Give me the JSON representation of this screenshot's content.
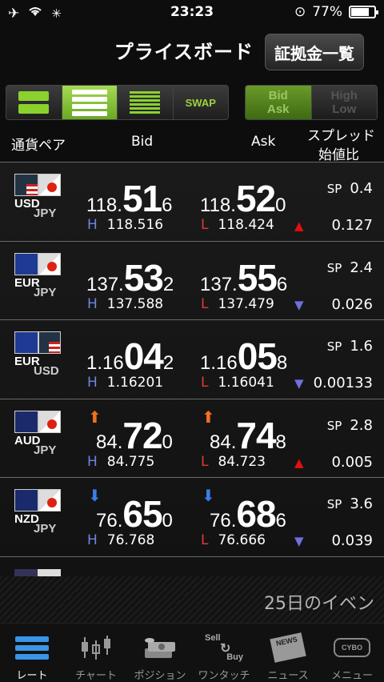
{
  "status": {
    "time": "23:23",
    "battery": "77%"
  },
  "header": {
    "title": "プライスボード",
    "button": "証拠金一覧"
  },
  "toggles": {
    "swap": "SWAP",
    "bidask_1": "Bid",
    "bidask_2": "Ask",
    "highlow_1": "High",
    "highlow_2": "Low"
  },
  "columns": {
    "pair": "通貨ペア",
    "bid": "Bid",
    "ask": "Ask",
    "spread": "スプレッド",
    "ratio": "始値比"
  },
  "rows": [
    {
      "base": "USD",
      "quote": "JPY",
      "bid_a": "118.",
      "bid_b": "51",
      "bid_c": "6",
      "ask_a": "118.",
      "ask_b": "52",
      "ask_c": "0",
      "h_label": "H",
      "high": "118.516",
      "l_label": "L",
      "low": "118.424",
      "sp_label": "SP",
      "sp": "0.4",
      "chg": "0.127",
      "dir": "up",
      "arrow": ""
    },
    {
      "base": "EUR",
      "quote": "JPY",
      "bid_a": "137.",
      "bid_b": "53",
      "bid_c": "2",
      "ask_a": "137.",
      "ask_b": "55",
      "ask_c": "6",
      "h_label": "H",
      "high": "137.588",
      "l_label": "L",
      "low": "137.479",
      "sp_label": "SP",
      "sp": "2.4",
      "chg": "0.026",
      "dir": "down",
      "arrow": ""
    },
    {
      "base": "EUR",
      "quote": "USD",
      "bid_a": "1.16",
      "bid_b": "04",
      "bid_c": "2",
      "ask_a": "1.16",
      "ask_b": "05",
      "ask_c": "8",
      "h_label": "H",
      "high": "1.16201",
      "l_label": "L",
      "low": "1.16041",
      "sp_label": "SP",
      "sp": "1.6",
      "chg": "0.00133",
      "dir": "down",
      "arrow": ""
    },
    {
      "base": "AUD",
      "quote": "JPY",
      "bid_a": "84.",
      "bid_b": "72",
      "bid_c": "0",
      "ask_a": "84.",
      "ask_b": "74",
      "ask_c": "8",
      "h_label": "H",
      "high": "84.775",
      "l_label": "L",
      "low": "84.723",
      "sp_label": "SP",
      "sp": "2.8",
      "chg": "0.005",
      "dir": "up",
      "arrow": "up"
    },
    {
      "base": "NZD",
      "quote": "JPY",
      "bid_a": "76.",
      "bid_b": "65",
      "bid_c": "0",
      "ask_a": "76.",
      "ask_b": "68",
      "ask_c": "6",
      "h_label": "H",
      "high": "76.768",
      "l_label": "L",
      "low": "76.666",
      "sp_label": "SP",
      "sp": "3.6",
      "chg": "0.039",
      "dir": "down",
      "arrow": "down"
    }
  ],
  "ticker": "25日のイベン",
  "tabs": [
    "レート",
    "チャート",
    "ポジション",
    "ワンタッチ",
    "ニュース",
    "メニュー"
  ],
  "tab_icon_text": {
    "onetouch_1": "Sell",
    "onetouch_2": "Buy",
    "news": "NEWS",
    "menu": "CYBO"
  }
}
